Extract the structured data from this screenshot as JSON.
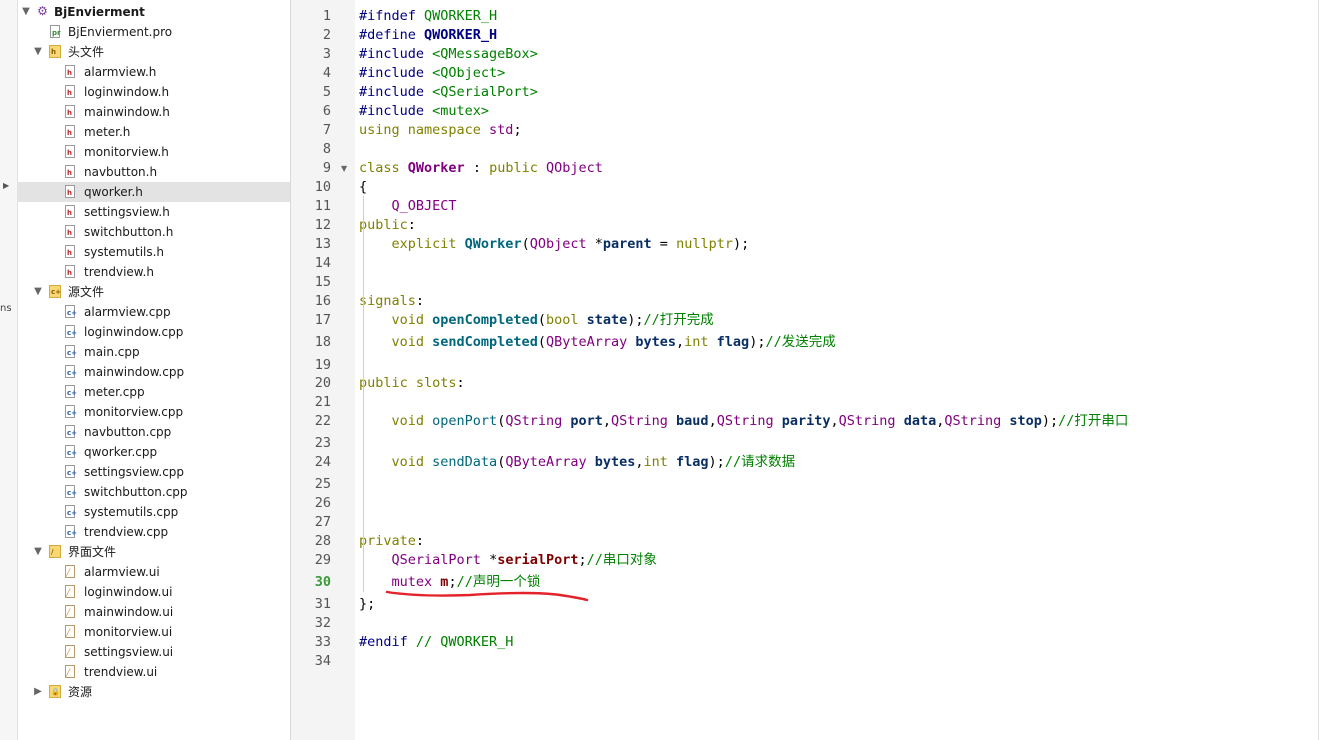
{
  "left_strip": {
    "ns_text": "ns"
  },
  "tree": {
    "project": "BjEnvierment",
    "pro_file": "BjEnvierment.pro",
    "headers_label": "头文件",
    "headers": [
      "alarmview.h",
      "loginwindow.h",
      "mainwindow.h",
      "meter.h",
      "monitorview.h",
      "navbutton.h",
      "qworker.h",
      "settingsview.h",
      "switchbutton.h",
      "systemutils.h",
      "trendview.h"
    ],
    "selected_header": "qworker.h",
    "sources_label": "源文件",
    "sources": [
      "alarmview.cpp",
      "loginwindow.cpp",
      "main.cpp",
      "mainwindow.cpp",
      "meter.cpp",
      "monitorview.cpp",
      "navbutton.cpp",
      "qworker.cpp",
      "settingsview.cpp",
      "switchbutton.cpp",
      "systemutils.cpp",
      "trendview.cpp"
    ],
    "forms_label": "界面文件",
    "forms": [
      "alarmview.ui",
      "loginwindow.ui",
      "mainwindow.ui",
      "monitorview.ui",
      "settingsview.ui",
      "trendview.ui"
    ],
    "resources_label": "资源"
  },
  "editor": {
    "current_line": 30,
    "line_numbers": [
      "1",
      "2",
      "3",
      "4",
      "5",
      "6",
      "7",
      "8",
      "9",
      "10",
      "11",
      "12",
      "13",
      "14",
      "15",
      "16",
      "17",
      "18",
      "19",
      "20",
      "21",
      "22",
      "23",
      "24",
      "25",
      "26",
      "27",
      "28",
      "29",
      "30",
      "31",
      "32",
      "33",
      "34"
    ],
    "lines": [
      [
        [
          "pp",
          "#ifndef "
        ],
        [
          "inc",
          "QWORKER_H"
        ]
      ],
      [
        [
          "pp",
          "#define "
        ],
        [
          "mac",
          "QWORKER_H"
        ]
      ],
      [
        [
          "pp",
          "#include "
        ],
        [
          "inc",
          "<QMessageBox>"
        ]
      ],
      [
        [
          "pp",
          "#include "
        ],
        [
          "inc",
          "<QObject>"
        ]
      ],
      [
        [
          "pp",
          "#include "
        ],
        [
          "inc",
          "<QSerialPort>"
        ]
      ],
      [
        [
          "pp",
          "#include "
        ],
        [
          "inc",
          "<mutex>"
        ]
      ],
      [
        [
          "kw",
          "using namespace "
        ],
        [
          "ty",
          "std"
        ],
        [
          "",
          "; "
        ]
      ],
      [],
      [
        [
          "kw",
          "class "
        ],
        [
          "cls",
          "QWorker"
        ],
        [
          "",
          " : "
        ],
        [
          "kw",
          "public "
        ],
        [
          "ty",
          "QObject"
        ]
      ],
      [
        [
          "",
          "{"
        ]
      ],
      [
        [
          "",
          "    "
        ],
        [
          "ty",
          "Q_OBJECT"
        ]
      ],
      [
        [
          "kw",
          "public"
        ],
        [
          "",
          ":"
        ]
      ],
      [
        [
          "",
          "    "
        ],
        [
          "kw",
          "explicit "
        ],
        [
          "fnb",
          "QWorker"
        ],
        [
          "",
          "("
        ],
        [
          "ty",
          "QObject"
        ],
        [
          "",
          " *"
        ],
        [
          "id",
          "parent"
        ],
        [
          "",
          " = "
        ],
        [
          "kw",
          "nullptr"
        ],
        [
          "",
          ");"
        ]
      ],
      [],
      [],
      [
        [
          "kw",
          "signals"
        ],
        [
          "",
          ":"
        ]
      ],
      [
        [
          "",
          "    "
        ],
        [
          "kw",
          "void "
        ],
        [
          "fnb",
          "openCompleted"
        ],
        [
          "",
          "("
        ],
        [
          "kw",
          "bool "
        ],
        [
          "id",
          "state"
        ],
        [
          "",
          ");"
        ],
        [
          "cm",
          "//打开完成"
        ]
      ],
      [
        [
          "",
          "    "
        ],
        [
          "kw",
          "void "
        ],
        [
          "fnb",
          "sendCompleted"
        ],
        [
          "",
          "("
        ],
        [
          "ty",
          "QByteArray "
        ],
        [
          "id",
          "bytes"
        ],
        [
          "",
          ","
        ],
        [
          "kw",
          "int "
        ],
        [
          "id",
          "flag"
        ],
        [
          "",
          ");"
        ],
        [
          "cm",
          "//发送完成"
        ]
      ],
      [],
      [
        [
          "kw",
          "public slots"
        ],
        [
          "",
          ":"
        ]
      ],
      [],
      [
        [
          "",
          "    "
        ],
        [
          "kw",
          "void "
        ],
        [
          "fn",
          "openPort"
        ],
        [
          "",
          "("
        ],
        [
          "ty",
          "QString "
        ],
        [
          "id",
          "port"
        ],
        [
          "",
          ","
        ],
        [
          "ty",
          "QString "
        ],
        [
          "id",
          "baud"
        ],
        [
          "",
          ","
        ],
        [
          "ty",
          "QString "
        ],
        [
          "id",
          "parity"
        ],
        [
          "",
          ","
        ],
        [
          "ty",
          "QString "
        ],
        [
          "id",
          "data"
        ],
        [
          "",
          ","
        ],
        [
          "ty",
          "QString "
        ],
        [
          "id",
          "stop"
        ],
        [
          "",
          ");"
        ],
        [
          "cm",
          "//打开串口"
        ]
      ],
      [],
      [
        [
          "",
          "    "
        ],
        [
          "kw",
          "void "
        ],
        [
          "fn",
          "sendData"
        ],
        [
          "",
          "("
        ],
        [
          "ty",
          "QByteArray "
        ],
        [
          "id",
          "bytes"
        ],
        [
          "",
          ","
        ],
        [
          "kw",
          "int "
        ],
        [
          "id",
          "flag"
        ],
        [
          "",
          ");"
        ],
        [
          "cm",
          "//请求数据"
        ]
      ],
      [],
      [],
      [],
      [
        [
          "kw",
          "private"
        ],
        [
          "",
          ":"
        ]
      ],
      [
        [
          "",
          "    "
        ],
        [
          "ty",
          "QSerialPort "
        ],
        [
          "",
          "*"
        ],
        [
          "mem",
          "serialPort"
        ],
        [
          "",
          ";"
        ],
        [
          "cm",
          "//串口对象"
        ]
      ],
      [
        [
          "",
          "    "
        ],
        [
          "ty",
          "mutex "
        ],
        [
          "mem",
          "m"
        ],
        [
          "",
          ";"
        ],
        [
          "cm",
          "//声明一个锁"
        ]
      ],
      [
        [
          "",
          "};"
        ]
      ],
      [],
      [
        [
          "pp",
          "#endif "
        ],
        [
          "cm",
          "// QWORKER_H"
        ]
      ],
      []
    ]
  },
  "annotation": {
    "underline_color": "#e3222a"
  }
}
